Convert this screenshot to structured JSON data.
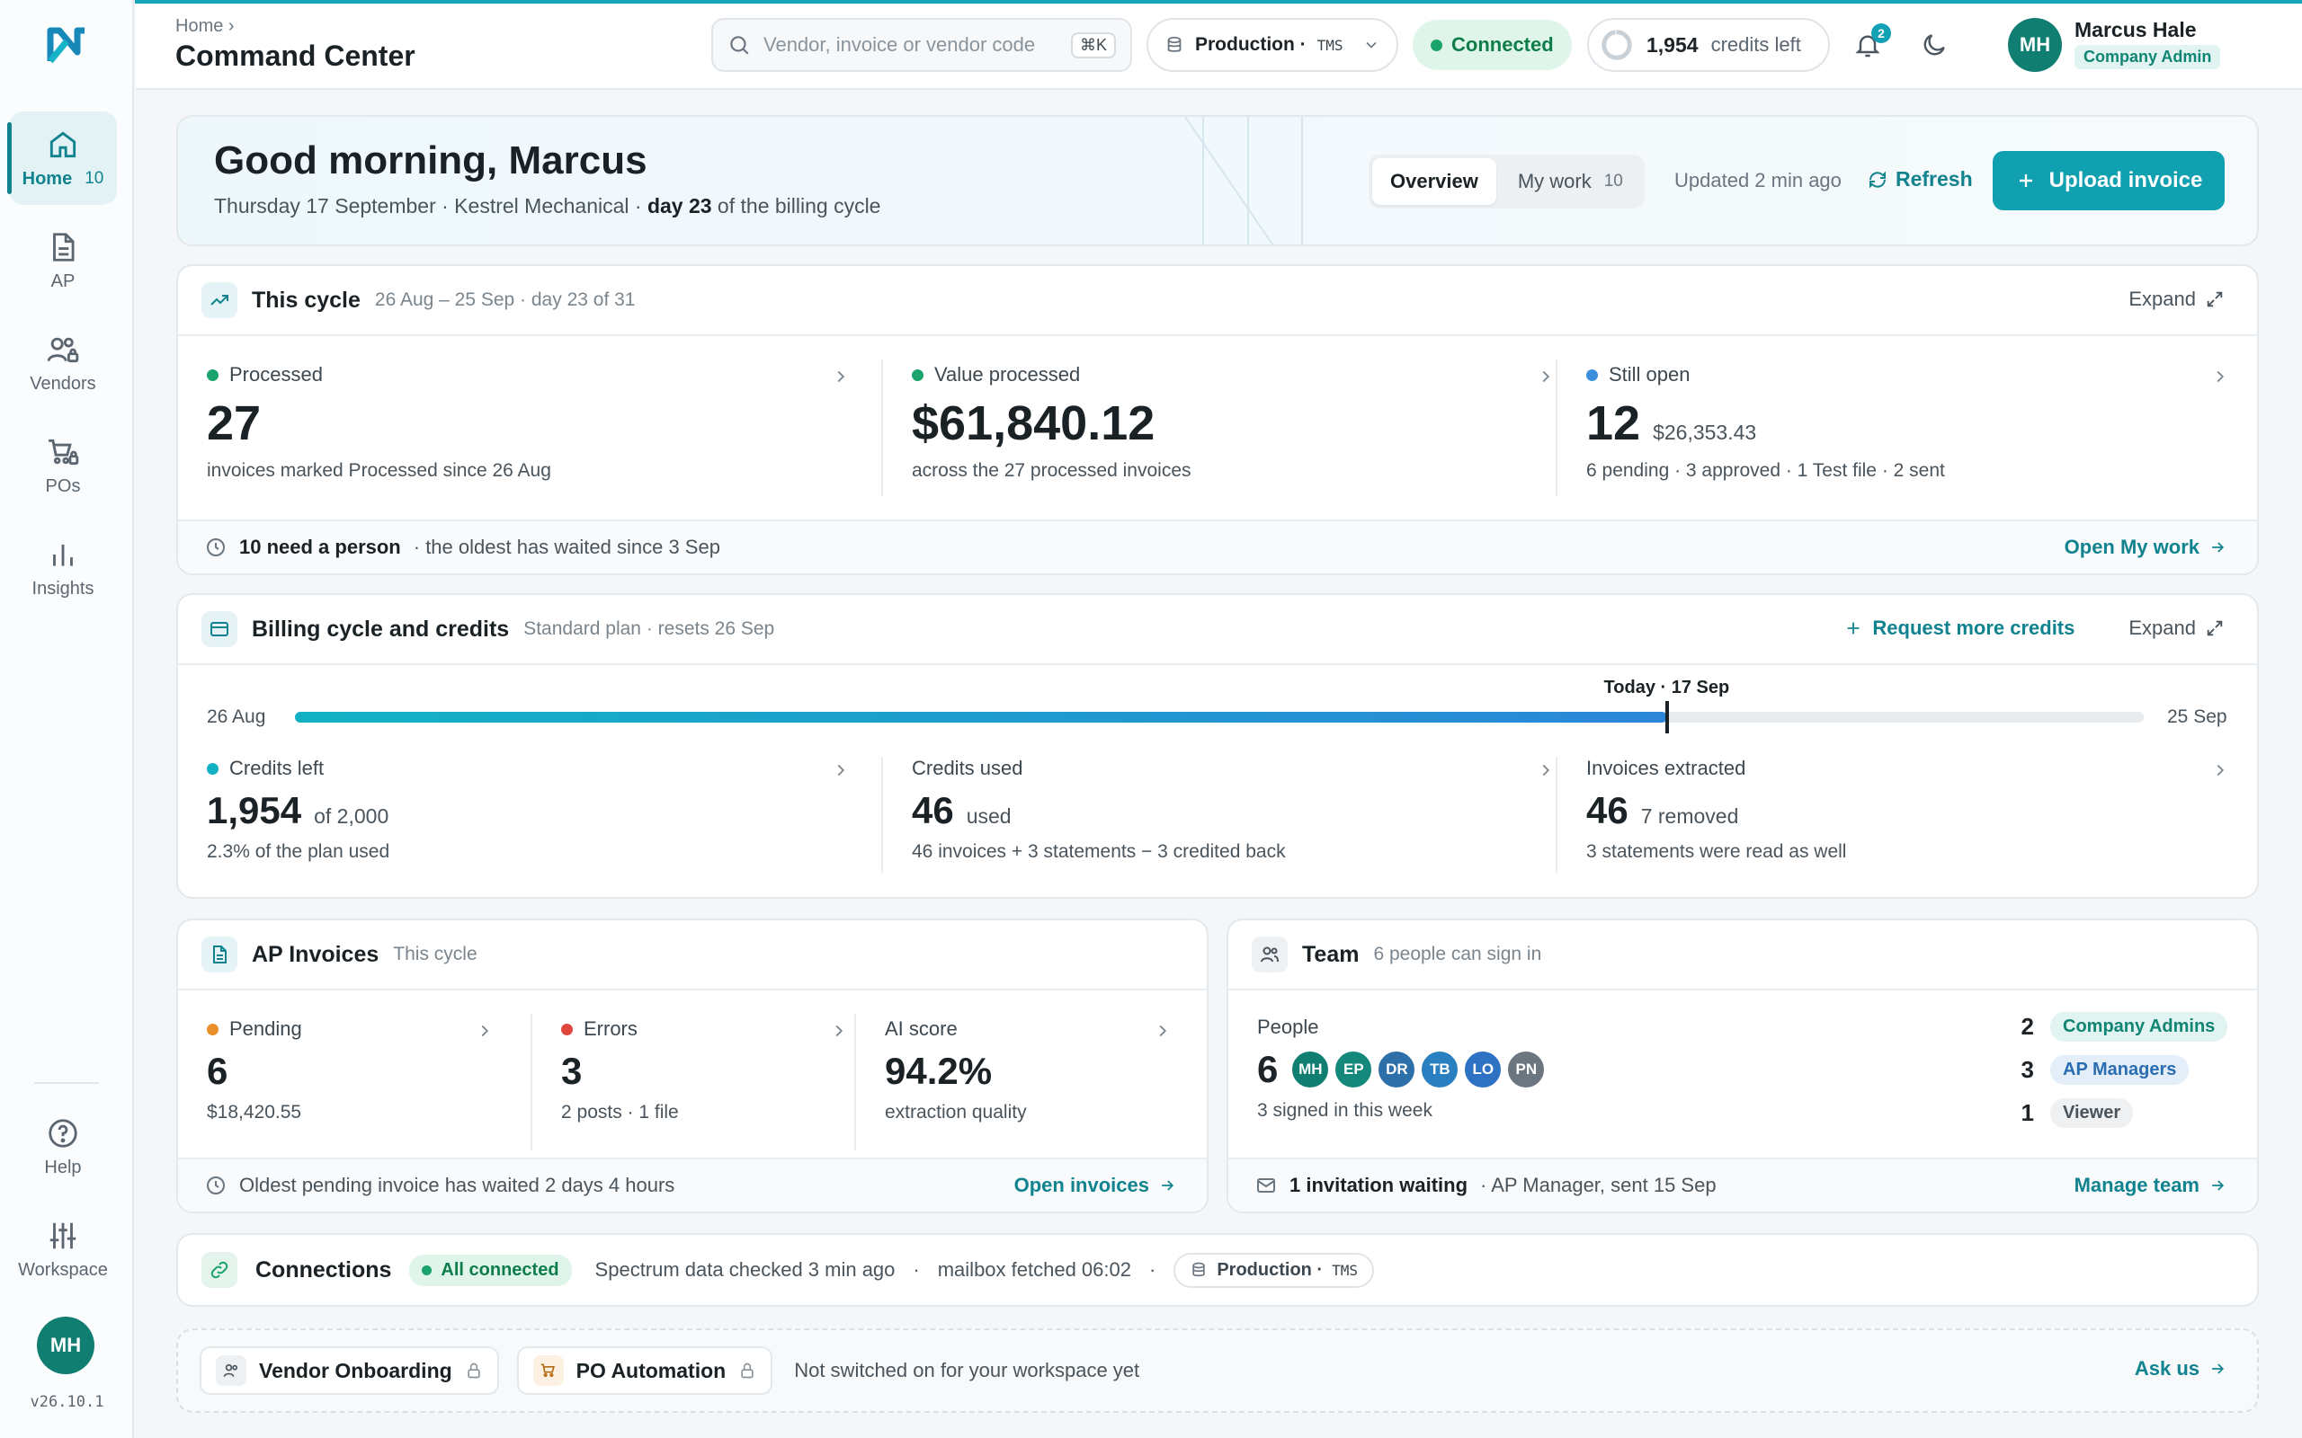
{
  "app": {
    "logo_letter": "N",
    "version": "v26.10.1",
    "accent": "#11a0b0"
  },
  "sidebar": {
    "items": [
      {
        "label": "Home",
        "count": "10",
        "icon": "home-icon",
        "active": true
      },
      {
        "label": "AP",
        "icon": "document-icon"
      },
      {
        "label": "Vendors",
        "icon": "users-lock-icon"
      },
      {
        "label": "POs",
        "icon": "cart-lock-icon"
      },
      {
        "label": "Insights",
        "icon": "bar-chart-icon"
      }
    ],
    "bottom": [
      {
        "label": "Help",
        "icon": "help-icon"
      },
      {
        "label": "Workspace",
        "icon": "sliders-icon"
      }
    ],
    "avatar_initials": "MH"
  },
  "header": {
    "breadcrumb": "Home",
    "title": "Command Center",
    "search_placeholder": "Vendor, invoice or vendor code",
    "search_shortcut": "⌘K",
    "environment": "Production ·",
    "environment_code": "TMS",
    "connection_status": "Connected",
    "credits_value": "1,954",
    "credits_label": "credits left",
    "notifications_count": "2",
    "user": {
      "initials": "MH",
      "name": "Marcus Hale",
      "role": "Company Admin"
    }
  },
  "hero": {
    "greeting": "Good morning, Marcus",
    "date_line_prefix": "Thursday 17 September · Kestrel Mechanical · ",
    "date_line_bold": "day 23",
    "date_line_suffix": " of the billing cycle",
    "tabs": [
      {
        "label": "Overview",
        "active": true
      },
      {
        "label": "My work",
        "count": "10"
      }
    ],
    "updated": "Updated 2 min ago",
    "refresh": "Refresh",
    "upload": "Upload invoice"
  },
  "cycle": {
    "title": "This cycle",
    "subtitle": "26 Aug – 25 Sep · day 23 of 31",
    "expand": "Expand",
    "metrics": [
      {
        "label": "Processed",
        "value": "27",
        "extra": "",
        "foot": "invoices marked Processed since 26 Aug",
        "dot": "#1aa36a"
      },
      {
        "label": "Value processed",
        "value": "$61,840.12",
        "extra": "",
        "foot": "across the 27 processed invoices",
        "dot": "#1aa36a"
      },
      {
        "label": "Still open",
        "value": "12",
        "extra": "$26,353.43",
        "foot": "6 pending · 3 approved · 1 Test file · 2 sent",
        "dot": "#3a8fdc"
      }
    ],
    "footer_bold": "10 need a person",
    "footer_text": "· the oldest has waited since 3 Sep",
    "footer_link": "Open My work"
  },
  "billing": {
    "title": "Billing cycle and credits",
    "subtitle": "Standard plan · resets 26 Sep",
    "request": "Request more credits",
    "expand": "Expand",
    "start_label": "26 Aug",
    "end_label": "25 Sep",
    "today_label": "Today · 17 Sep",
    "progress_fraction": 0.742,
    "metrics": [
      {
        "label": "Credits left",
        "value": "1,954",
        "extra": "of 2,000",
        "foot": "2.3% of the plan used",
        "dot": "#12b2c4"
      },
      {
        "label": "Credits used",
        "value": "46",
        "extra": "used",
        "foot": "46 invoices + 3 statements − 3 credited back"
      },
      {
        "label": "Invoices extracted",
        "value": "46",
        "extra": "7 removed",
        "foot": "3 statements were read as well"
      }
    ]
  },
  "ap": {
    "title": "AP Invoices",
    "subtitle": "This cycle",
    "metrics": [
      {
        "label": "Pending",
        "value": "6",
        "foot": "$18,420.55",
        "dot": "#e8902a"
      },
      {
        "label": "Errors",
        "value": "3",
        "foot": "2 posts · 1 file",
        "dot": "#e0463c"
      },
      {
        "label": "AI score",
        "value": "94.2%",
        "foot": "extraction quality"
      }
    ],
    "footer_text": "Oldest pending invoice has waited 2 days 4 hours",
    "footer_link": "Open invoices"
  },
  "team": {
    "title": "Team",
    "subtitle": "6 people can sign in",
    "people_label": "People",
    "people_count": "6",
    "signed_in": "3 signed in this week",
    "avatars": [
      {
        "initials": "MH",
        "color": "#117e72"
      },
      {
        "initials": "EP",
        "color": "#14897b"
      },
      {
        "initials": "DR",
        "color": "#2d6fa8"
      },
      {
        "initials": "TB",
        "color": "#2a7fc0"
      },
      {
        "initials": "LO",
        "color": "#2e72c4"
      },
      {
        "initials": "PN",
        "color": "#6b7680"
      }
    ],
    "roles": [
      {
        "count": "2",
        "label": "Company Admins",
        "bg": "#e1f4f1",
        "fg": "#118573"
      },
      {
        "count": "3",
        "label": "AP Managers",
        "bg": "#e3eef9",
        "fg": "#2a6db0"
      },
      {
        "count": "1",
        "label": "Viewer",
        "bg": "#eef0f2",
        "fg": "#4a545c"
      }
    ],
    "footer_bold": "1 invitation waiting",
    "footer_text": "· AP Manager, sent 15 Sep",
    "footer_link": "Manage team"
  },
  "connections": {
    "title": "Connections",
    "status": "All connected",
    "spectrum": "Spectrum data checked 3 min ago",
    "mailbox": "mailbox fetched 06:02",
    "env": "Production ·",
    "env_code": "TMS"
  },
  "locked": {
    "items": [
      {
        "label": "Vendor Onboarding",
        "icon": "users-icon"
      },
      {
        "label": "PO Automation",
        "icon": "cart-icon"
      }
    ],
    "message": "Not switched on for your workspace yet",
    "link": "Ask us"
  }
}
